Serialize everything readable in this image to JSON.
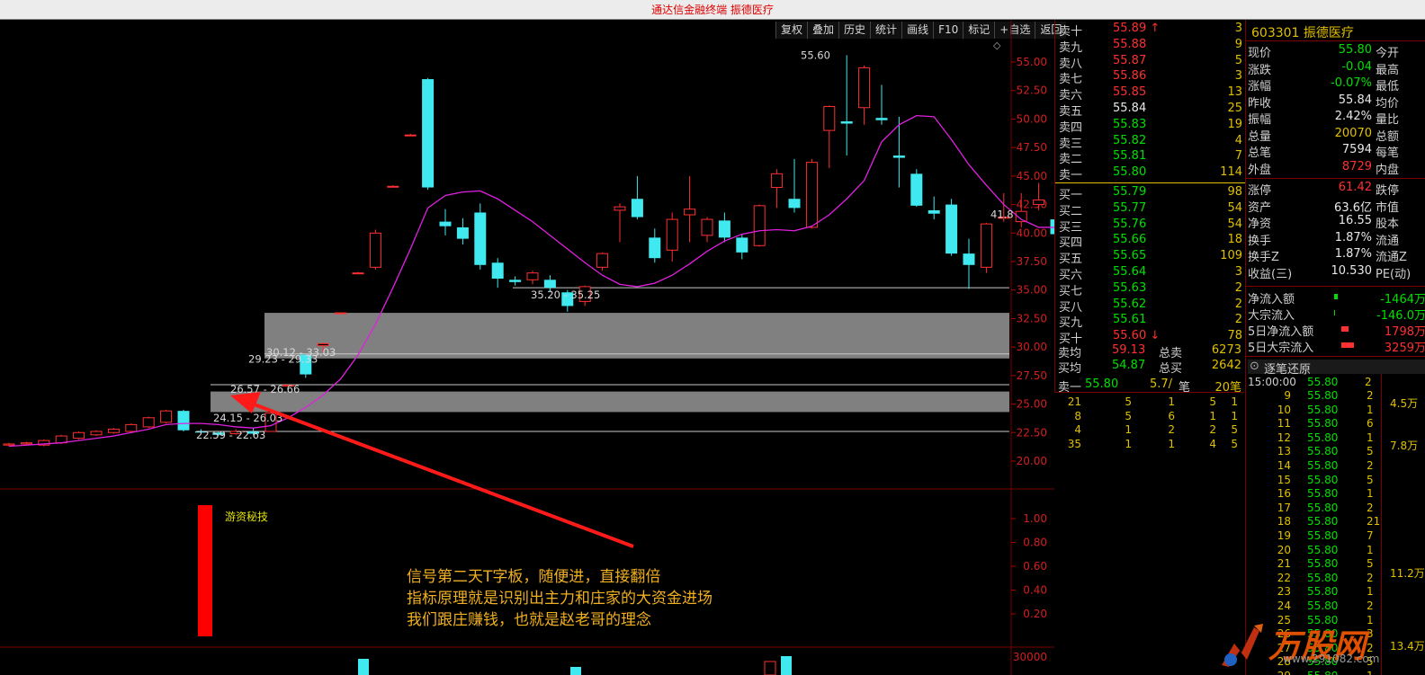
{
  "window": {
    "title": "通达信金融终端  振德医疗"
  },
  "toolbar": {
    "items": [
      "复权",
      "叠加",
      "历史",
      "统计",
      "画线",
      "F10",
      "标记",
      "+自选",
      "返回"
    ]
  },
  "chart_data": {
    "type": "candlestick",
    "title": "",
    "y_ticks": [
      55.0,
      52.5,
      50.0,
      47.5,
      45.0,
      42.5,
      40.0,
      37.5,
      35.0,
      32.5,
      30.0,
      27.5,
      25.0,
      22.5,
      20.0
    ],
    "ylim": [
      18.5,
      56.5
    ],
    "candles": [
      {
        "o": 21.4,
        "h": 21.6,
        "l": 21.3,
        "c": 21.5
      },
      {
        "o": 21.5,
        "h": 21.7,
        "l": 21.4,
        "c": 21.6
      },
      {
        "o": 21.4,
        "h": 21.9,
        "l": 21.3,
        "c": 21.8
      },
      {
        "o": 21.6,
        "h": 22.3,
        "l": 21.5,
        "c": 22.2
      },
      {
        "o": 22.0,
        "h": 22.6,
        "l": 21.9,
        "c": 22.5
      },
      {
        "o": 22.3,
        "h": 22.7,
        "l": 22.2,
        "c": 22.6
      },
      {
        "o": 22.5,
        "h": 22.9,
        "l": 22.4,
        "c": 22.8
      },
      {
        "o": 22.6,
        "h": 23.3,
        "l": 22.5,
        "c": 23.2
      },
      {
        "o": 23.0,
        "h": 23.9,
        "l": 22.9,
        "c": 23.8
      },
      {
        "o": 23.4,
        "h": 24.5,
        "l": 23.3,
        "c": 24.4
      },
      {
        "o": 24.4,
        "h": 24.5,
        "l": 22.6,
        "c": 22.7
      },
      {
        "o": 22.6,
        "h": 22.8,
        "l": 22.4,
        "c": 22.5
      },
      {
        "o": 22.5,
        "h": 22.6,
        "l": 22.2,
        "c": 22.3
      },
      {
        "o": 22.4,
        "h": 22.8,
        "l": 22.3,
        "c": 22.6
      },
      {
        "o": 22.6,
        "h": 22.9,
        "l": 22.3,
        "c": 22.4
      },
      {
        "o": 22.6,
        "h": 24.2,
        "l": 22.6,
        "c": 24.2
      },
      {
        "o": 26.57,
        "h": 26.66,
        "l": 26.57,
        "c": 26.66
      },
      {
        "o": 29.33,
        "h": 29.33,
        "l": 27.3,
        "c": 27.6
      },
      {
        "o": 30.12,
        "h": 30.4,
        "l": 29.5,
        "c": 30.3
      },
      {
        "o": 33.0,
        "h": 33.03,
        "l": 33.0,
        "c": 33.0
      },
      {
        "o": 36.5,
        "h": 36.6,
        "l": 36.4,
        "c": 36.5
      },
      {
        "o": 37.0,
        "h": 40.3,
        "l": 36.8,
        "c": 40.0
      },
      {
        "o": 44.1,
        "h": 44.2,
        "l": 44.0,
        "c": 44.1
      },
      {
        "o": 48.6,
        "h": 48.7,
        "l": 48.5,
        "c": 48.6
      },
      {
        "o": 53.5,
        "h": 53.6,
        "l": 43.8,
        "c": 44.0
      },
      {
        "o": 41.0,
        "h": 42.1,
        "l": 39.8,
        "c": 40.6
      },
      {
        "o": 40.5,
        "h": 41.3,
        "l": 39.0,
        "c": 39.5
      },
      {
        "o": 41.8,
        "h": 42.6,
        "l": 36.8,
        "c": 37.2
      },
      {
        "o": 37.4,
        "h": 37.8,
        "l": 35.2,
        "c": 36.0
      },
      {
        "o": 35.9,
        "h": 36.2,
        "l": 35.4,
        "c": 35.7
      },
      {
        "o": 35.9,
        "h": 36.7,
        "l": 35.5,
        "c": 36.5
      },
      {
        "o": 35.9,
        "h": 36.3,
        "l": 34.8,
        "c": 35.2
      },
      {
        "o": 34.8,
        "h": 35.0,
        "l": 33.1,
        "c": 33.6
      },
      {
        "o": 34.0,
        "h": 35.4,
        "l": 33.6,
        "c": 35.3
      },
      {
        "o": 37.0,
        "h": 38.3,
        "l": 36.7,
        "c": 38.2
      },
      {
        "o": 42.0,
        "h": 42.6,
        "l": 39.2,
        "c": 42.3
      },
      {
        "o": 43.0,
        "h": 45.0,
        "l": 41.2,
        "c": 41.4
      },
      {
        "o": 39.6,
        "h": 40.4,
        "l": 37.4,
        "c": 37.8
      },
      {
        "o": 38.5,
        "h": 41.8,
        "l": 37.5,
        "c": 41.2
      },
      {
        "o": 41.6,
        "h": 45.0,
        "l": 39.2,
        "c": 42.1
      },
      {
        "o": 39.8,
        "h": 41.4,
        "l": 39.2,
        "c": 41.2
      },
      {
        "o": 41.1,
        "h": 41.8,
        "l": 39.2,
        "c": 39.6
      },
      {
        "o": 39.6,
        "h": 39.9,
        "l": 37.7,
        "c": 38.3
      },
      {
        "o": 38.9,
        "h": 42.5,
        "l": 38.8,
        "c": 42.4
      },
      {
        "o": 44.0,
        "h": 45.6,
        "l": 42.2,
        "c": 45.2
      },
      {
        "o": 43.0,
        "h": 46.5,
        "l": 41.8,
        "c": 42.2
      },
      {
        "o": 40.5,
        "h": 46.5,
        "l": 40.4,
        "c": 46.2
      },
      {
        "o": 49.0,
        "h": 51.2,
        "l": 45.7,
        "c": 51.1
      },
      {
        "o": 49.8,
        "h": 55.6,
        "l": 46.8,
        "c": 49.6
      },
      {
        "o": 51.0,
        "h": 54.7,
        "l": 49.5,
        "c": 54.5
      },
      {
        "o": 50.1,
        "h": 53.0,
        "l": 49.5,
        "c": 49.9
      },
      {
        "o": 46.8,
        "h": 50.2,
        "l": 44.0,
        "c": 46.6
      },
      {
        "o": 45.2,
        "h": 45.6,
        "l": 42.3,
        "c": 42.4
      },
      {
        "o": 42.0,
        "h": 43.2,
        "l": 41.2,
        "c": 41.7
      },
      {
        "o": 42.5,
        "h": 43.0,
        "l": 38.0,
        "c": 38.2
      },
      {
        "o": 38.2,
        "h": 39.5,
        "l": 35.1,
        "c": 37.2
      },
      {
        "o": 37.0,
        "h": 40.9,
        "l": 36.5,
        "c": 40.8
      },
      {
        "o": 41.3,
        "h": 43.5,
        "l": 41.0,
        "c": 41.4
      },
      {
        "o": 41.0,
        "h": 43.5,
        "l": 40.5,
        "c": 41.9
      },
      {
        "o": 42.5,
        "h": 44.4,
        "l": 42.0,
        "c": 42.9
      },
      {
        "o": 41.2,
        "h": 41.8,
        "l": 39.6,
        "c": 39.9
      }
    ],
    "ma": [
      21.3,
      21.4,
      21.5,
      21.6,
      21.8,
      22.0,
      22.2,
      22.5,
      22.8,
      23.2,
      23.3,
      23.3,
      23.2,
      23.0,
      22.9,
      23.1,
      23.8,
      24.7,
      25.8,
      27.2,
      29.3,
      32.0,
      35.2,
      38.6,
      42.2,
      43.3,
      43.6,
      43.7,
      43.0,
      42.0,
      41.0,
      39.8,
      38.6,
      37.4,
      36.3,
      35.5,
      35.3,
      35.6,
      36.3,
      37.3,
      38.4,
      39.3,
      39.9,
      40.2,
      40.3,
      40.2,
      40.6,
      41.6,
      43.0,
      44.6,
      48.0,
      49.5,
      50.3,
      50.2,
      48.2,
      46.0,
      44.2,
      42.5,
      41.2,
      40.5,
      40.5,
      40.9,
      41.3
    ],
    "price_annotations": [
      "55.60",
      "35.20 - 35.25",
      "30.12 - 33.03",
      "29.23 - 29.33",
      "26.57 - 26.66",
      "24.15 - 26.03",
      "22.59 - 22.63",
      "41.8"
    ],
    "zones": [
      [
        29.0,
        33.0
      ],
      [
        24.3,
        26.1
      ]
    ],
    "levels": [
      35.2,
      29.4,
      26.7,
      22.6
    ],
    "indicator": {
      "label": "游资秘技",
      "ticks": [
        "1.00",
        "0.80",
        "0.60",
        "0.40",
        "0.20"
      ],
      "signal_value": 1.0
    },
    "volume_ticks": [
      "30000"
    ]
  },
  "annotation": {
    "lines": [
      "信号第二天T字板，随便进，直接翻倍",
      "指标原理就是识别出主力和庄家的大资金进场",
      "我们跟庄赚钱，也就是赵老哥的理念"
    ]
  },
  "order_book": {
    "asks": [
      {
        "label": "卖十",
        "price": "55.89",
        "vol": "3",
        "color": "red",
        "mark": "↑"
      },
      {
        "label": "卖九",
        "price": "55.88",
        "vol": "9",
        "color": "red"
      },
      {
        "label": "卖八",
        "price": "55.87",
        "vol": "5",
        "color": "red"
      },
      {
        "label": "卖七",
        "price": "55.86",
        "vol": "3",
        "color": "red"
      },
      {
        "label": "卖六",
        "price": "55.85",
        "vol": "13",
        "color": "red"
      },
      {
        "label": "卖五",
        "price": "55.84",
        "vol": "25",
        "color": "white"
      },
      {
        "label": "卖四",
        "price": "55.83",
        "vol": "19",
        "color": "green"
      },
      {
        "label": "卖三",
        "price": "55.82",
        "vol": "4",
        "color": "green"
      },
      {
        "label": "卖二",
        "price": "55.81",
        "vol": "7",
        "color": "green"
      },
      {
        "label": "卖一",
        "price": "55.80",
        "vol": "114",
        "color": "green"
      }
    ],
    "bids": [
      {
        "label": "买一",
        "price": "55.79",
        "vol": "98",
        "color": "green"
      },
      {
        "label": "买二",
        "price": "55.77",
        "vol": "54",
        "color": "green"
      },
      {
        "label": "买三",
        "price": "55.76",
        "vol": "54",
        "color": "green"
      },
      {
        "label": "买四",
        "price": "55.66",
        "vol": "18",
        "color": "green"
      },
      {
        "label": "买五",
        "price": "55.65",
        "vol": "109",
        "color": "green"
      },
      {
        "label": "买六",
        "price": "55.64",
        "vol": "3",
        "color": "green"
      },
      {
        "label": "买七",
        "price": "55.63",
        "vol": "2",
        "color": "green"
      },
      {
        "label": "买八",
        "price": "55.62",
        "vol": "2",
        "color": "green"
      },
      {
        "label": "买九",
        "price": "55.61",
        "vol": "2",
        "color": "green"
      },
      {
        "label": "买十",
        "price": "55.60",
        "vol": "78",
        "color": "red",
        "mark": "↓"
      }
    ],
    "avg_sell": {
      "label": "卖均",
      "price": "59.13",
      "sum_label": "总卖",
      "sum": "6273"
    },
    "avg_buy": {
      "label": "买均",
      "price": "54.87",
      "sum_label": "总买",
      "sum": "2642"
    },
    "sell1": {
      "label": "卖一",
      "price": "55.80",
      "per": "5.7/",
      "unit": "笔",
      "count": "20笔"
    },
    "queue": [
      [
        "21",
        "5",
        "1",
        "5",
        "1"
      ],
      [
        "8",
        "5",
        "6",
        "1",
        "1"
      ],
      [
        "4",
        "1",
        "2",
        "2",
        "5"
      ],
      [
        "35",
        "1",
        "1",
        "4",
        "5"
      ]
    ]
  },
  "info": {
    "code": "603301",
    "name": "振德医疗",
    "rows": [
      {
        "l": "现价",
        "v": "55.80",
        "c": "green",
        "r": "今开"
      },
      {
        "l": "涨跌",
        "v": "-0.04",
        "c": "green",
        "r": "最高"
      },
      {
        "l": "涨幅",
        "v": "-0.07%",
        "c": "green",
        "r": "最低"
      },
      {
        "l": "昨收",
        "v": "55.84",
        "c": "white",
        "r": "均价"
      },
      {
        "l": "振幅",
        "v": "2.42%",
        "c": "white",
        "r": "量比"
      },
      {
        "l": "总量",
        "v": "20070",
        "c": "yellow",
        "r": "总额"
      },
      {
        "l": "总笔",
        "v": "7594",
        "c": "white",
        "r": "每笔"
      },
      {
        "l": "外盘",
        "v": "8729",
        "c": "red",
        "r": "内盘"
      },
      {
        "l": "涨停",
        "v": "61.42",
        "c": "red",
        "r": "跌停"
      },
      {
        "l": "资产",
        "v": "63.6亿",
        "c": "white",
        "r": "市值"
      },
      {
        "l": "净资",
        "v": "16.55",
        "c": "white",
        "r": "股本"
      },
      {
        "l": "换手",
        "v": "1.87%",
        "c": "white",
        "r": "流通"
      },
      {
        "l": "换手Z",
        "v": "1.87%",
        "c": "white",
        "r": "流通Z"
      },
      {
        "l": "收益(三)",
        "v": "10.530",
        "c": "white",
        "r": "PE(动)"
      }
    ],
    "flows": [
      {
        "l": "净流入额",
        "v": "-1464万",
        "c": "green"
      },
      {
        "l": "大宗流入",
        "v": "-146.0万",
        "c": "green"
      },
      {
        "l": "5日净流入额",
        "v": "1798万",
        "c": "red"
      },
      {
        "l": "5日大宗流入",
        "v": "3259万",
        "c": "red"
      }
    ],
    "ticks_header": "逐笔还原",
    "ticks_time": "15:00:00",
    "ticks": [
      {
        "n": "9",
        "p": "55.80",
        "v": "2"
      },
      {
        "n": "10",
        "p": "55.80",
        "v": "1"
      },
      {
        "n": "11",
        "p": "55.80",
        "v": "6"
      },
      {
        "n": "12",
        "p": "55.80",
        "v": "1"
      },
      {
        "n": "13",
        "p": "55.80",
        "v": "5"
      },
      {
        "n": "14",
        "p": "55.80",
        "v": "2"
      },
      {
        "n": "15",
        "p": "55.80",
        "v": "5"
      },
      {
        "n": "16",
        "p": "55.80",
        "v": "1"
      },
      {
        "n": "17",
        "p": "55.80",
        "v": "2"
      },
      {
        "n": "18",
        "p": "55.80",
        "v": "21"
      },
      {
        "n": "19",
        "p": "55.80",
        "v": "7"
      },
      {
        "n": "20",
        "p": "55.80",
        "v": "1"
      },
      {
        "n": "21",
        "p": "55.80",
        "v": "5"
      },
      {
        "n": "22",
        "p": "55.80",
        "v": "2"
      },
      {
        "n": "23",
        "p": "55.80",
        "v": "1"
      },
      {
        "n": "24",
        "p": "55.80",
        "v": "2"
      },
      {
        "n": "25",
        "p": "55.80",
        "v": "1"
      },
      {
        "n": "26",
        "p": "55.80",
        "v": "3"
      },
      {
        "n": "27",
        "p": "55.80",
        "v": "2"
      },
      {
        "n": "28",
        "p": "55.80",
        "v": "5"
      },
      {
        "n": "29",
        "p": "55.80",
        "v": "1"
      }
    ],
    "side_values": [
      "4.5万",
      "7.8万",
      "11.2万",
      "13.4万"
    ]
  },
  "watermark": {
    "text": "万股网",
    "url": "www.291082.com"
  },
  "colors": {
    "up": "#ff3030",
    "down": "#40e8f0",
    "ma": "#e020e0",
    "zone": "#808080",
    "arrow": "#ff1a1a"
  }
}
